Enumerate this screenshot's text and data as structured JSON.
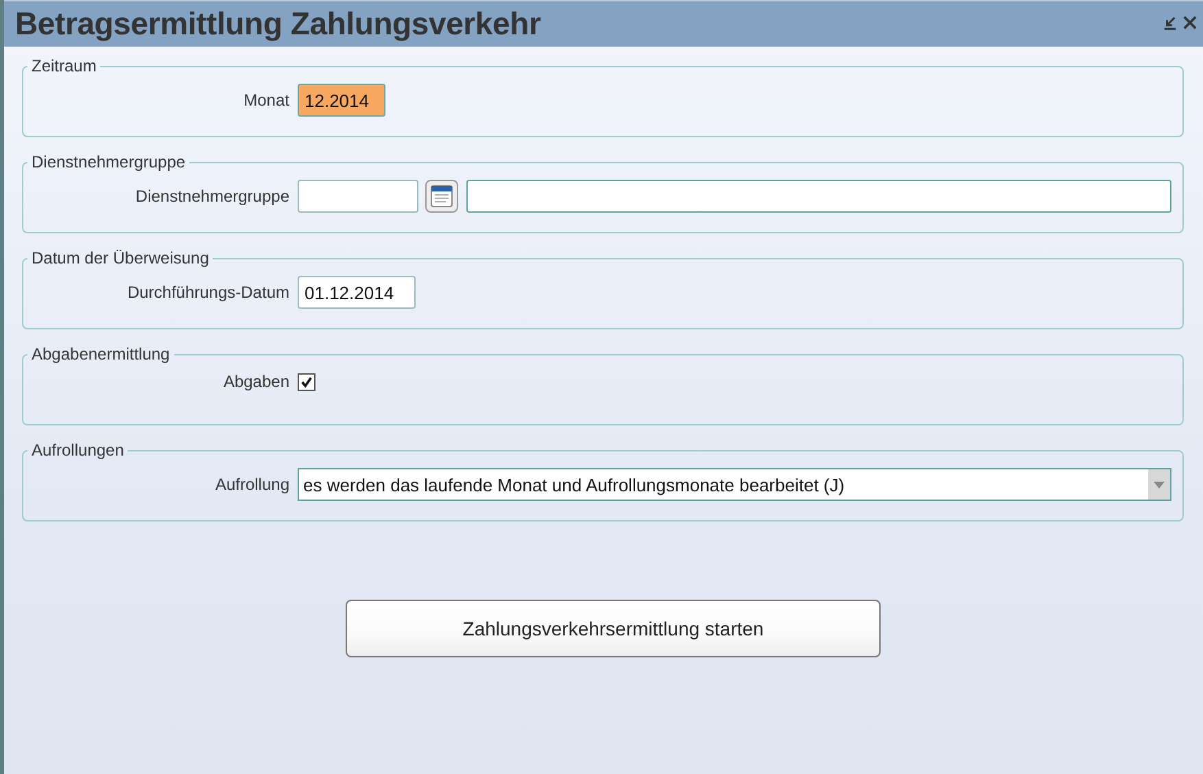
{
  "window": {
    "title": "Betragsermittlung Zahlungsverkehr"
  },
  "sections": [
    {
      "legend": "Zeitraum",
      "fields": [
        {
          "kind": "text",
          "label": "Monat",
          "value": "12.2014",
          "highlighted": true
        }
      ]
    },
    {
      "legend": "Dienstnehmergruppe",
      "fields": [
        {
          "kind": "lookup",
          "label": "Dienstnehmergruppe"
        }
      ]
    },
    {
      "legend": "Datum der Überweisung",
      "fields": [
        {
          "kind": "text",
          "label": "Durchführungs-Datum",
          "value": "01.12.2014",
          "highlighted": false
        }
      ]
    },
    {
      "legend": "Abgabenermittlung",
      "fields": [
        {
          "kind": "checkbox",
          "label": "Abgaben",
          "checked": true
        }
      ]
    },
    {
      "legend": "Aufrollungen",
      "fields": [
        {
          "kind": "select",
          "label": "Aufrollung",
          "value": "es werden das laufende Monat und Aufrollungsmonate bearbeitet (J)"
        }
      ]
    }
  ],
  "button": {
    "label": "Zahlungsverkehrsermittlung starten"
  }
}
